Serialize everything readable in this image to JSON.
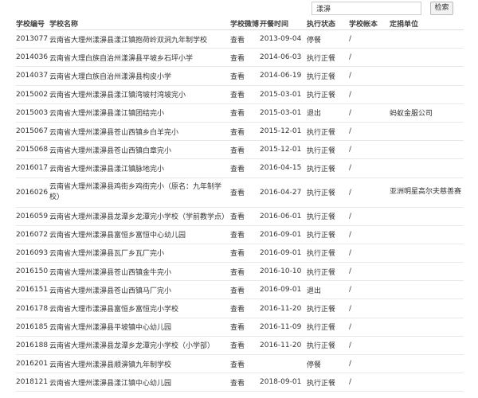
{
  "search": {
    "value": "漾濞",
    "button_label": "检索"
  },
  "table": {
    "headers": {
      "code": "学校编号",
      "name": "学校名称",
      "weibo": "学校微博",
      "date": "开餐时间",
      "status": "执行状态",
      "account": "学校帐本",
      "unit": "定捐单位"
    },
    "rows": [
      {
        "code": "2013077",
        "name": "云南省大理州漾濞县漾江镇抱荷岭双涧九年制学校",
        "weibo": "查看",
        "date": "2013-09-04",
        "status": "停餐",
        "account": "/",
        "unit": ""
      },
      {
        "code": "2014036",
        "name": "云南省大理白族自治州漾濞县平坡乡石坪小学",
        "weibo": "查看",
        "date": "2014-06-03",
        "status": "执行正餐",
        "account": "/",
        "unit": ""
      },
      {
        "code": "2014037",
        "name": "云南省大理白族自治州漾濞县枸皮小学",
        "weibo": "查看",
        "date": "2014-06-19",
        "status": "执行正餐",
        "account": "/",
        "unit": ""
      },
      {
        "code": "2015002",
        "name": "云南省大理州漾濞县漾江镇湾坡村湾坡完小",
        "weibo": "查看",
        "date": "2015-03-01",
        "status": "执行正餐",
        "account": "/",
        "unit": ""
      },
      {
        "code": "2015003",
        "name": "云南省大理州漾濞县漾江镇团结完小",
        "weibo": "查看",
        "date": "2015-03-01",
        "status": "退出",
        "account": "/",
        "unit": "蚂蚁金服公司"
      },
      {
        "code": "2015067",
        "name": "云南省大理州漾濞县苍山西镇乡白羊完小",
        "weibo": "查看",
        "date": "2015-12-01",
        "status": "执行正餐",
        "account": "/",
        "unit": ""
      },
      {
        "code": "2015068",
        "name": "云南省大理州漾濞县苍山西镇白章完小",
        "weibo": "查看",
        "date": "2015-12-01",
        "status": "执行正餐",
        "account": "/",
        "unit": ""
      },
      {
        "code": "2016017",
        "name": "云南省大理州漾濞县漾江镇脉地完小",
        "weibo": "查看",
        "date": "2016-04-15",
        "status": "执行正餐",
        "account": "/",
        "unit": ""
      },
      {
        "code": "2016026",
        "name": "云南省大理州漾濞县鸡街乡鸡街完小（原名：九年制学校）",
        "weibo": "查看",
        "date": "2016-04-27",
        "status": "执行正餐",
        "account": "/",
        "unit": "亚洲明星高尔夫慈善赛",
        "tall": true
      },
      {
        "code": "2016059",
        "name": "云南省大理州漾濞县龙潭乡龙潭完小学校（学前教学点）",
        "weibo": "查看",
        "date": "2016-06-01",
        "status": "执行正餐",
        "account": "/",
        "unit": ""
      },
      {
        "code": "2016072",
        "name": "云南省大理州漾濞县富恒乡富恒中心幼儿园",
        "weibo": "查看",
        "date": "2016-09-01",
        "status": "执行正餐",
        "account": "/",
        "unit": ""
      },
      {
        "code": "2016093",
        "name": "云南省大理州漾濞县瓦厂乡瓦厂完小",
        "weibo": "查看",
        "date": "2016-09-01",
        "status": "执行正餐",
        "account": "/",
        "unit": ""
      },
      {
        "code": "2016150",
        "name": "云南省大理州漾濞县苍山西镇金牛完小",
        "weibo": "查看",
        "date": "2016-10-10",
        "status": "执行正餐",
        "account": "/",
        "unit": ""
      },
      {
        "code": "2016151",
        "name": "云南省大理州漾濞县苍山西镇马厂完小",
        "weibo": "查看",
        "date": "2016-09-01",
        "status": "退出",
        "account": "/",
        "unit": ""
      },
      {
        "code": "2016178",
        "name": "云南省大理市漾濞县富恒乡富恒完小学校",
        "weibo": "查看",
        "date": "2016-11-20",
        "status": "执行正餐",
        "account": "/",
        "unit": ""
      },
      {
        "code": "2016185",
        "name": "云南省大理州漾濞县平坡镇中心幼儿园",
        "weibo": "查看",
        "date": "2016-11-09",
        "status": "执行正餐",
        "account": "/",
        "unit": ""
      },
      {
        "code": "2016188",
        "name": "云南省大理州漾濞县龙潭乡龙潭完小学校（小学部）",
        "weibo": "查看",
        "date": "2016-11-20",
        "status": "执行正餐",
        "account": "/",
        "unit": ""
      },
      {
        "code": "2016201",
        "name": "云南省大理州漾濞县顺濞镇九年制学校",
        "weibo": "查看",
        "date": "",
        "status": "停餐",
        "account": "/",
        "unit": ""
      },
      {
        "code": "2018121",
        "name": "云南省大理州漾濞县漾江镇中心幼儿园",
        "weibo": "查看",
        "date": "2018-09-01",
        "status": "执行正餐",
        "account": "/",
        "unit": ""
      }
    ]
  }
}
